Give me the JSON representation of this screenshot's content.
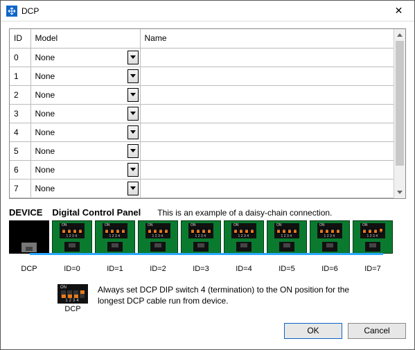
{
  "window": {
    "title": "DCP"
  },
  "table": {
    "headers": {
      "id": "ID",
      "model": "Model",
      "name": "Name"
    },
    "rows": [
      {
        "id": "0",
        "model": "None",
        "name": ""
      },
      {
        "id": "1",
        "model": "None",
        "name": ""
      },
      {
        "id": "2",
        "model": "None",
        "name": ""
      },
      {
        "id": "3",
        "model": "None",
        "name": ""
      },
      {
        "id": "4",
        "model": "None",
        "name": ""
      },
      {
        "id": "5",
        "model": "None",
        "name": ""
      },
      {
        "id": "6",
        "model": "None",
        "name": ""
      },
      {
        "id": "7",
        "model": "None",
        "name": ""
      }
    ]
  },
  "diagram": {
    "device_label": "DEVICE",
    "panel_label": "Digital Control Panel",
    "subtitle": "This is an example of a daisy-chain connection.",
    "device_caption": "DCP",
    "ids": [
      "ID=0",
      "ID=1",
      "ID=2",
      "ID=3",
      "ID=4",
      "ID=5",
      "ID=6",
      "ID=7"
    ]
  },
  "note": {
    "dip_label": "DCP",
    "text": "Always set DCP DIP switch 4 (termination) to the ON position for the longest DCP cable run from device."
  },
  "buttons": {
    "ok": "OK",
    "cancel": "Cancel"
  }
}
